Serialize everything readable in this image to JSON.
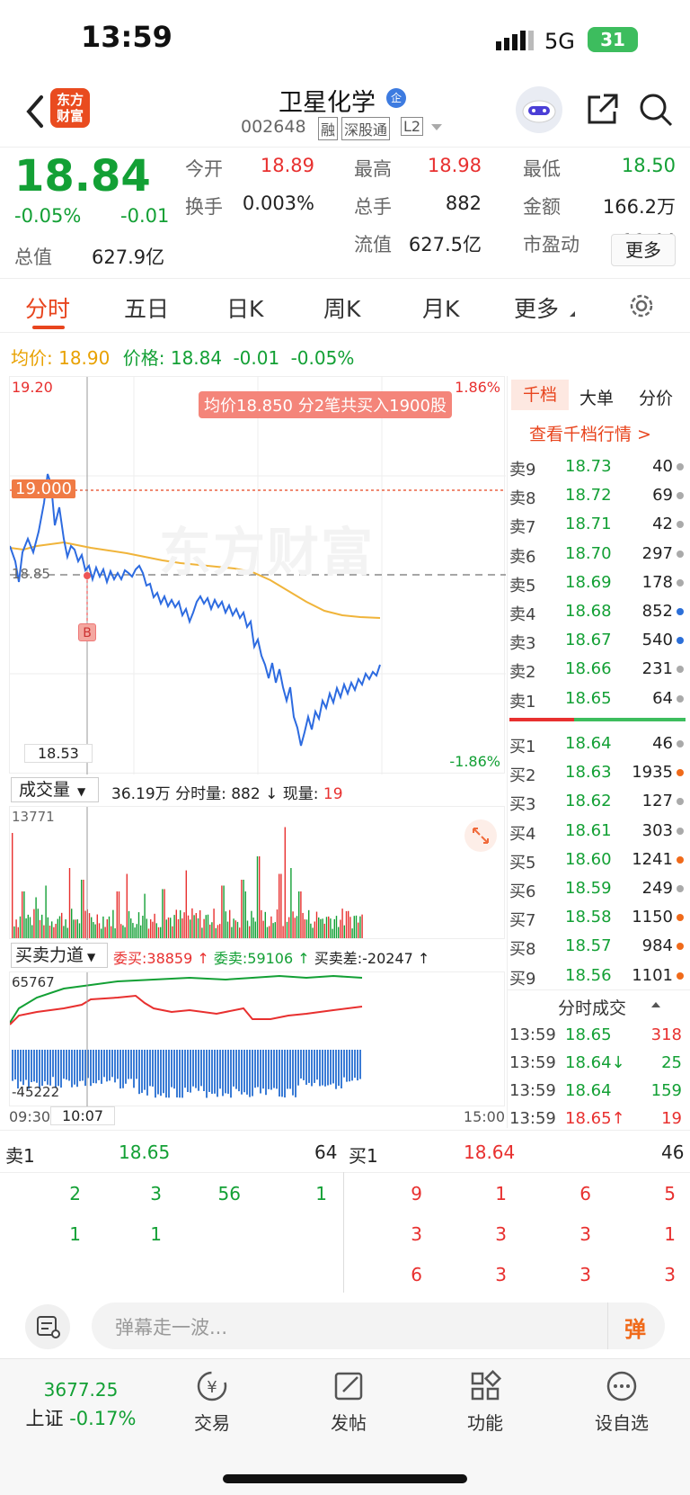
{
  "status": {
    "time": "13:59",
    "network": "5G",
    "battery": "31"
  },
  "header": {
    "name": "卫星化学",
    "tag": "企",
    "code": "002648",
    "badges": [
      "融",
      "深股通",
      "L2"
    ]
  },
  "quote": {
    "price": "18.84",
    "pct": "-0.05%",
    "chg": "-0.01",
    "fields": [
      {
        "label": "今开",
        "value": "18.89",
        "color": "red"
      },
      {
        "label": "最高",
        "value": "18.98",
        "color": "red"
      },
      {
        "label": "最低",
        "value": "18.50",
        "color": "green"
      },
      {
        "label": "换手",
        "value": "0.003%",
        "color": "dark"
      },
      {
        "label": "总手",
        "value": "882",
        "color": "dark"
      },
      {
        "label": "金额",
        "value": "166.2万",
        "color": "dark"
      },
      {
        "label": "总值",
        "value": "627.9亿",
        "color": "dark"
      },
      {
        "label": "流值",
        "value": "627.5亿",
        "color": "dark"
      },
      {
        "label": "市盈动",
        "value": "11.44",
        "color": "dark"
      }
    ],
    "more": "更多"
  },
  "tabs": [
    "分时",
    "五日",
    "日K",
    "周K",
    "月K",
    "更多"
  ],
  "info_bar": {
    "avg_label": "均价:",
    "avg": "18.90",
    "price_label": "价格:",
    "price": "18.84",
    "chg": "-0.01",
    "pct": "-0.05%"
  },
  "chart": {
    "y_top": "19.20",
    "y_bottom": "18.53",
    "pct_top": "1.86%",
    "pct_bottom": "-1.86%",
    "ref": "18.85",
    "marker": "19.000",
    "buy_marker": "B",
    "tooltip": "均价18.850  分2笔共买入1900股",
    "time_start": "09:30",
    "time_cursor": "10:07",
    "time_end": "15:00"
  },
  "volume": {
    "selector": "成交量",
    "total": "36.19万",
    "split_label": "分时量:",
    "split": "882",
    "now_label": "现量:",
    "now": "19",
    "max": "13771"
  },
  "power": {
    "selector": "买卖力道",
    "buy": "委买:38859",
    "sell": "委卖:59106",
    "diff": "买卖差:-20247",
    "top": "65767",
    "bottom": "-45222"
  },
  "orderbook_tabs": [
    "千档",
    "大单",
    "分价"
  ],
  "orderbook_link": "查看千档行情 >",
  "asks": [
    {
      "l": "卖9",
      "p": "18.73",
      "v": "40",
      "d": "gray"
    },
    {
      "l": "卖8",
      "p": "18.72",
      "v": "69",
      "d": "gray"
    },
    {
      "l": "卖7",
      "p": "18.71",
      "v": "42",
      "d": "gray"
    },
    {
      "l": "卖6",
      "p": "18.70",
      "v": "297",
      "d": "gray"
    },
    {
      "l": "卖5",
      "p": "18.69",
      "v": "178",
      "d": "gray"
    },
    {
      "l": "卖4",
      "p": "18.68",
      "v": "852",
      "d": "blue"
    },
    {
      "l": "卖3",
      "p": "18.67",
      "v": "540",
      "d": "blue"
    },
    {
      "l": "卖2",
      "p": "18.66",
      "v": "231",
      "d": "gray"
    },
    {
      "l": "卖1",
      "p": "18.65",
      "v": "64",
      "d": "gray"
    }
  ],
  "bids": [
    {
      "l": "买1",
      "p": "18.64",
      "v": "46",
      "d": "gray"
    },
    {
      "l": "买2",
      "p": "18.63",
      "v": "1935",
      "d": "orange"
    },
    {
      "l": "买3",
      "p": "18.62",
      "v": "127",
      "d": "gray"
    },
    {
      "l": "买4",
      "p": "18.61",
      "v": "303",
      "d": "gray"
    },
    {
      "l": "买5",
      "p": "18.60",
      "v": "1241",
      "d": "orange"
    },
    {
      "l": "买6",
      "p": "18.59",
      "v": "249",
      "d": "gray"
    },
    {
      "l": "买7",
      "p": "18.58",
      "v": "1150",
      "d": "orange"
    },
    {
      "l": "买8",
      "p": "18.57",
      "v": "984",
      "d": "orange"
    },
    {
      "l": "买9",
      "p": "18.56",
      "v": "1101",
      "d": "orange"
    }
  ],
  "ticks_title": "分时成交",
  "ticks": [
    {
      "t": "13:59",
      "p": "18.65",
      "v": "318",
      "vc": "red"
    },
    {
      "t": "13:59",
      "p": "18.64↓",
      "v": "25",
      "vc": "green"
    },
    {
      "t": "13:59",
      "p": "18.64",
      "v": "159",
      "vc": "green"
    },
    {
      "t": "13:59",
      "p": "18.65↑",
      "v": "19",
      "vc": "red"
    }
  ],
  "queue": {
    "sell_label": "卖1",
    "sell_price": "18.65",
    "sell_total": "64",
    "buy_label": "买1",
    "buy_price": "18.64",
    "buy_total": "46",
    "sell_rows": [
      [
        "2",
        "3",
        "56",
        "1"
      ],
      [
        "1",
        "1",
        "",
        ""
      ]
    ],
    "buy_rows": [
      [
        "9",
        "1",
        "6",
        "5"
      ],
      [
        "3",
        "3",
        "3",
        "1"
      ],
      [
        "6",
        "3",
        "3",
        "3"
      ]
    ]
  },
  "danmu": {
    "placeholder": "弹幕走一波...",
    "button": "弹"
  },
  "bottom_nav": {
    "index_value": "3677.25",
    "index_name": "上证",
    "index_pct": "-0.17%",
    "items": [
      "交易",
      "发帖",
      "功能",
      "设自选"
    ]
  }
}
